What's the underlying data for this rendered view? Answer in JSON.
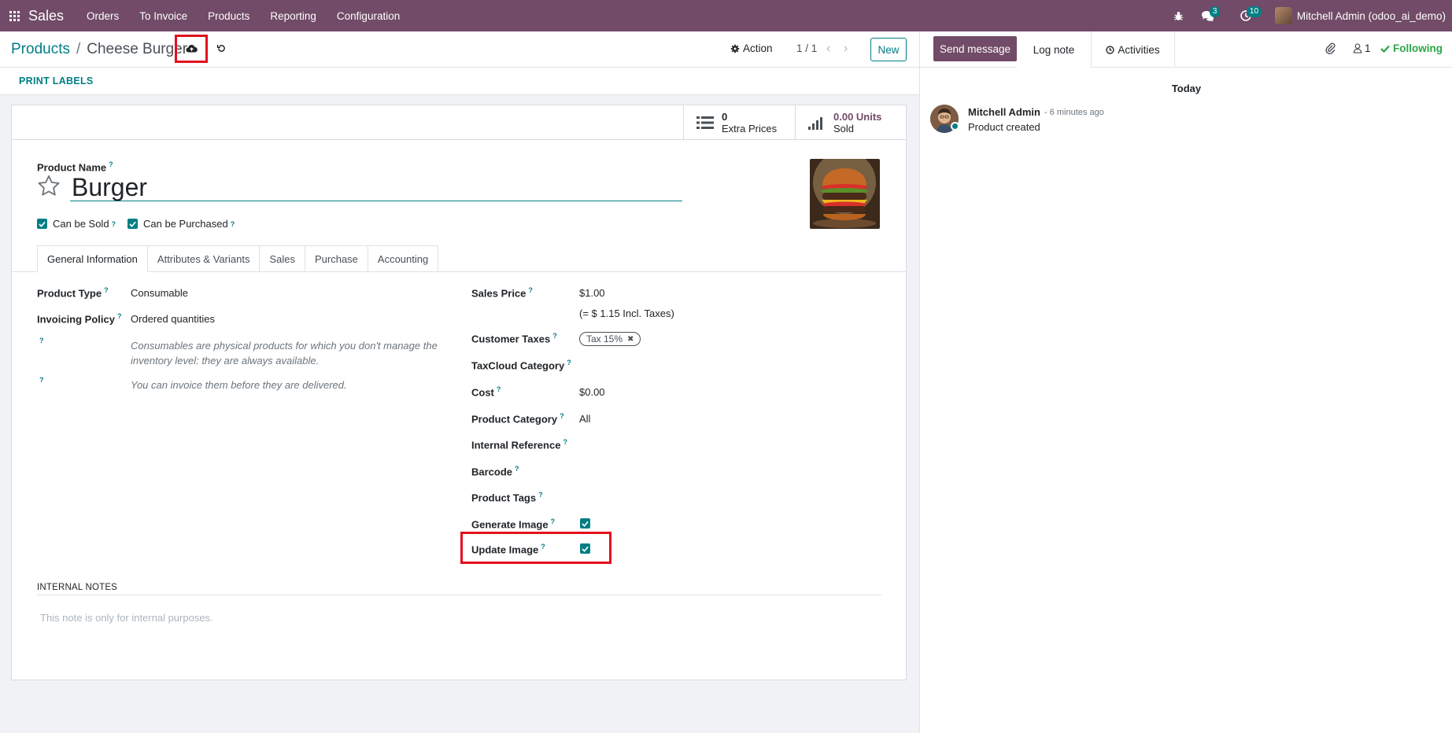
{
  "navbar": {
    "app_name": "Sales",
    "menu": [
      "Orders",
      "To Invoice",
      "Products",
      "Reporting",
      "Configuration"
    ],
    "messages_count": "3",
    "activities_count": "10",
    "user_name": "Mitchell Admin (odoo_ai_demo)"
  },
  "control": {
    "breadcrumb_parent": "Products",
    "breadcrumb_current": "Cheese Burger",
    "action_label": "Action",
    "pager": "1 / 1",
    "new_label": "New"
  },
  "statusbar": {
    "print_labels": "PRINT LABELS"
  },
  "stat_buttons": {
    "extra_prices_value": "0",
    "extra_prices_label": "Extra Prices",
    "sold_value": "0.00 Units",
    "sold_label": "Sold"
  },
  "product": {
    "name_label": "Product Name",
    "name": "Burger",
    "can_be_sold_label": "Can be Sold",
    "can_be_purchased_label": "Can be Purchased",
    "can_be_sold": true,
    "can_be_purchased": true
  },
  "tabs": [
    "General Information",
    "Attributes & Variants",
    "Sales",
    "Purchase",
    "Accounting"
  ],
  "general": {
    "product_type_label": "Product Type",
    "product_type": "Consumable",
    "invoicing_policy_label": "Invoicing Policy",
    "invoicing_policy": "Ordered quantities",
    "help_consumable": "Consumables are physical products for which you don't manage the inventory level: they are always available.",
    "help_invoice": "You can invoice them before they are delivered.",
    "sales_price_label": "Sales Price",
    "sales_price": "$1.00",
    "incl_taxes": "(= $ 1.15 Incl. Taxes)",
    "customer_taxes_label": "Customer Taxes",
    "tax_tag": "Tax 15%",
    "taxcloud_label": "TaxCloud Category",
    "cost_label": "Cost",
    "cost": "$0.00",
    "product_category_label": "Product Category",
    "product_category": "All",
    "internal_ref_label": "Internal Reference",
    "barcode_label": "Barcode",
    "product_tags_label": "Product Tags",
    "generate_image_label": "Generate Image",
    "update_image_label": "Update Image",
    "generate_image": true,
    "update_image": true
  },
  "notes": {
    "title": "INTERNAL NOTES",
    "placeholder": "This note is only for internal purposes."
  },
  "chatter": {
    "send_message": "Send message",
    "log_note": "Log note",
    "activities": "Activities",
    "followers_count": "1",
    "following": "Following",
    "today": "Today",
    "message_author": "Mitchell Admin",
    "message_time": "- 6 minutes ago",
    "message_body": "Product created"
  },
  "colors": {
    "brand": "#714b67",
    "accent": "#017e84",
    "highlight": "#e3101d"
  }
}
